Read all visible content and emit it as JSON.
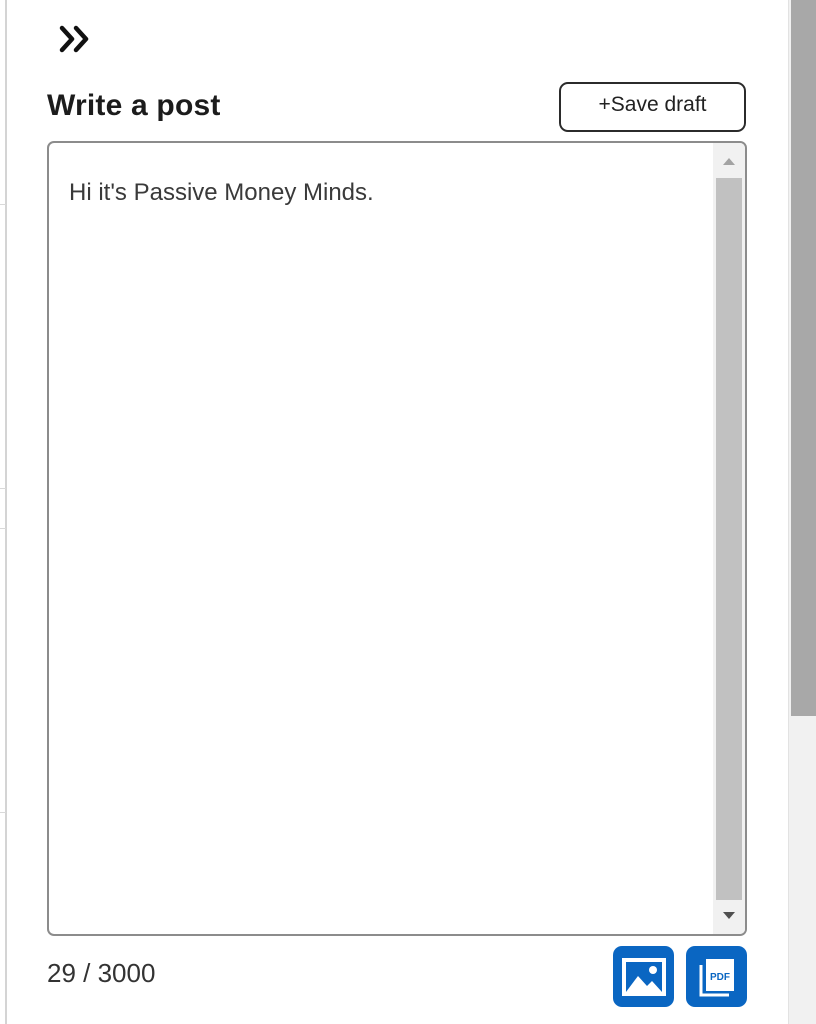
{
  "header": {
    "collapse_icon": "double-chevron-right-icon",
    "title": "Write a post",
    "save_draft_label": "+Save draft"
  },
  "editor": {
    "text": "Hi it's Passive Money Minds."
  },
  "footer": {
    "char_count": "29 / 3000",
    "image_icon": "image-icon",
    "pdf_icon": "pdf-icon",
    "pdf_icon_text": "PDF"
  },
  "colors": {
    "accent": "#0a66c2",
    "text": "#1c1c1c",
    "border": "#8c8c8c"
  }
}
